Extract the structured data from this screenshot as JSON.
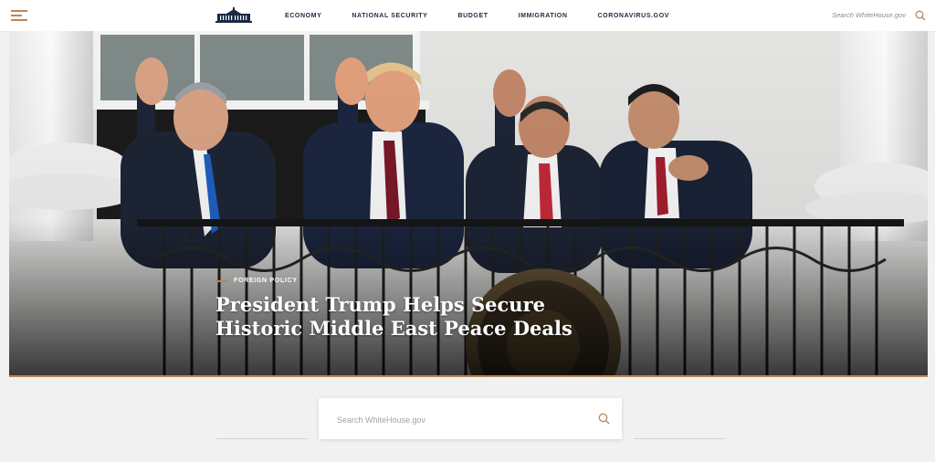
{
  "header": {
    "menu_icon": "hamburger-menu-icon",
    "logo_icon": "white-house-logo-icon",
    "nav": [
      "ECONOMY",
      "NATIONAL SECURITY",
      "BUDGET",
      "IMMIGRATION",
      "CORONAVIRUS.GOV"
    ],
    "search_label": "Search WhiteHouse.gov",
    "search_icon": "search-icon"
  },
  "hero": {
    "category": "FOREIGN POLICY",
    "headline": "President Trump Helps Secure Historic Middle East Peace Deals",
    "image": "four-leaders-waving-on-white-house-balcony"
  },
  "search": {
    "placeholder": "Search WhiteHouse.gov",
    "icon": "search-icon"
  },
  "colors": {
    "accent": "#b7865b",
    "navy": "#1a2a44",
    "background": "#f1f1f1"
  }
}
